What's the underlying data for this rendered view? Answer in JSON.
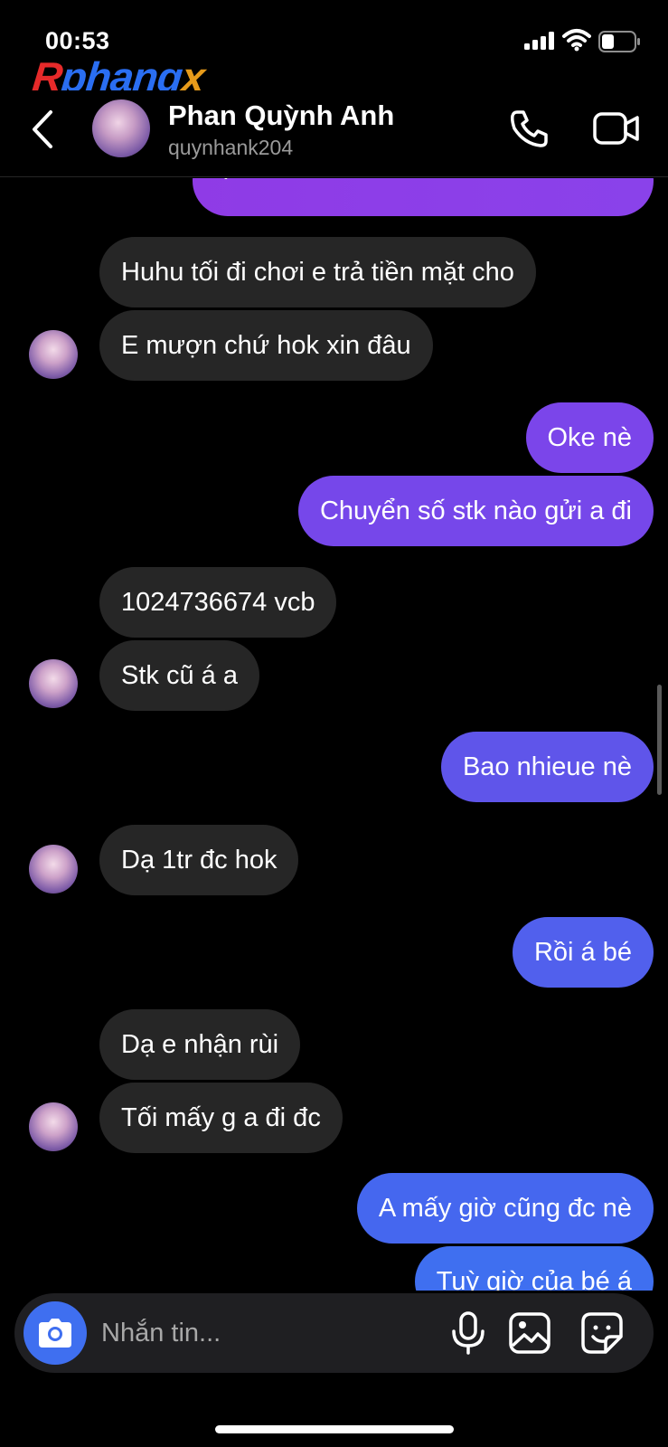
{
  "status_bar": {
    "time": "00:53"
  },
  "watermark": {
    "part1": "R",
    "part2": "phang",
    "part3": "x"
  },
  "header": {
    "name": "Phan Quỳnh Anh",
    "username": "quynhank204"
  },
  "messages": [
    {
      "from": "me",
      "text": "quá"
    },
    {
      "from": "them",
      "text": "Huhu tối đi chơi e trả tiền mặt cho"
    },
    {
      "from": "them",
      "text": "E mượn chứ hok xin đâu"
    },
    {
      "from": "me",
      "text": "Oke nè"
    },
    {
      "from": "me",
      "text": "Chuyển số stk nào gửi a đi"
    },
    {
      "from": "them",
      "text": "1024736674 vcb"
    },
    {
      "from": "them",
      "text": "Stk cũ á a"
    },
    {
      "from": "me",
      "text": "Bao nhieue nè"
    },
    {
      "from": "them",
      "text": "Dạ 1tr đc hok"
    },
    {
      "from": "me",
      "text": "Rồi á bé"
    },
    {
      "from": "them",
      "text": "Dạ e nhận rùi"
    },
    {
      "from": "them",
      "text": "Tối mấy g a đi đc"
    },
    {
      "from": "me",
      "text": "A mấy giờ cũng đc nè"
    },
    {
      "from": "me",
      "text": "Tuỳ giờ của bé á"
    }
  ],
  "composer": {
    "placeholder": "Nhắn tin..."
  },
  "colors": {
    "background": "#000000",
    "incoming_bubble": "#262626",
    "outgoing_top": "#8a3be8",
    "outgoing_bottom": "#3f6ff0",
    "camera_button": "#3f6ff0"
  }
}
